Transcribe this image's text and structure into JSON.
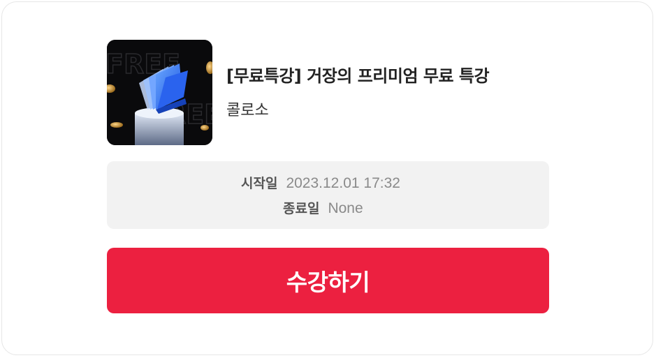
{
  "course": {
    "thumbnail_alt": "free-lecture-thumbnail",
    "thumbnail_text_top": "FREE",
    "thumbnail_text_bottom": "FREE",
    "title": "[무료특강] 거장의 프리미엄 무료 특강",
    "author": "콜로소"
  },
  "schedule": {
    "start_label": "시작일",
    "start_value": "2023.12.01 17:32",
    "end_label": "종료일",
    "end_value": "None"
  },
  "actions": {
    "enroll_label": "수강하기"
  },
  "colors": {
    "accent": "#ec2040",
    "info_bg": "#f2f2f2",
    "title_text": "#222222",
    "value_text": "#8a8a8a"
  }
}
